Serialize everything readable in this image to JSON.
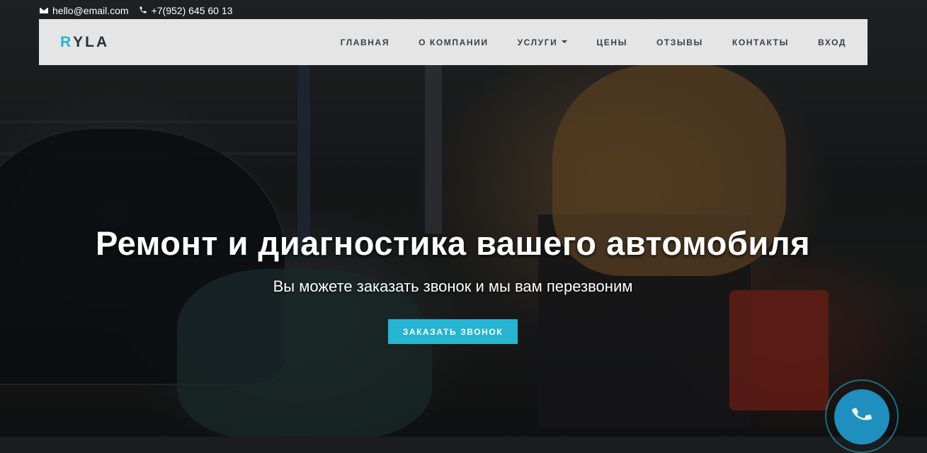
{
  "contacts": {
    "email": "hello@email.com",
    "phone": "+7(952) 645 60 13",
    "email_icon": "envelope-icon",
    "phone_icon": "phone-icon"
  },
  "brand": {
    "logo_first": "R",
    "logo_rest": "YLA",
    "accent_color": "#22b4d6"
  },
  "nav": {
    "items": [
      {
        "label": "ГЛАВНАЯ"
      },
      {
        "label": "О КОМПАНИИ"
      },
      {
        "label": "УСЛУГИ",
        "dropdown_icon": "caret-down-icon"
      },
      {
        "label": "ЦЕНЫ"
      },
      {
        "label": "ОТЗЫВЫ"
      },
      {
        "label": "КОНТАКТЫ"
      },
      {
        "label": "ВХОД"
      }
    ]
  },
  "hero": {
    "headline": "Ремонт и диагностика вашего автомобиля",
    "subline": "Вы можете заказать звонок и мы вам перезвоним",
    "cta_label": "ЗАКАЗАТЬ ЗВОНОК",
    "cta_color": "#27b5d4"
  },
  "call_widget": {
    "icon": "phone-handset-icon",
    "color": "#1f8fc0"
  }
}
